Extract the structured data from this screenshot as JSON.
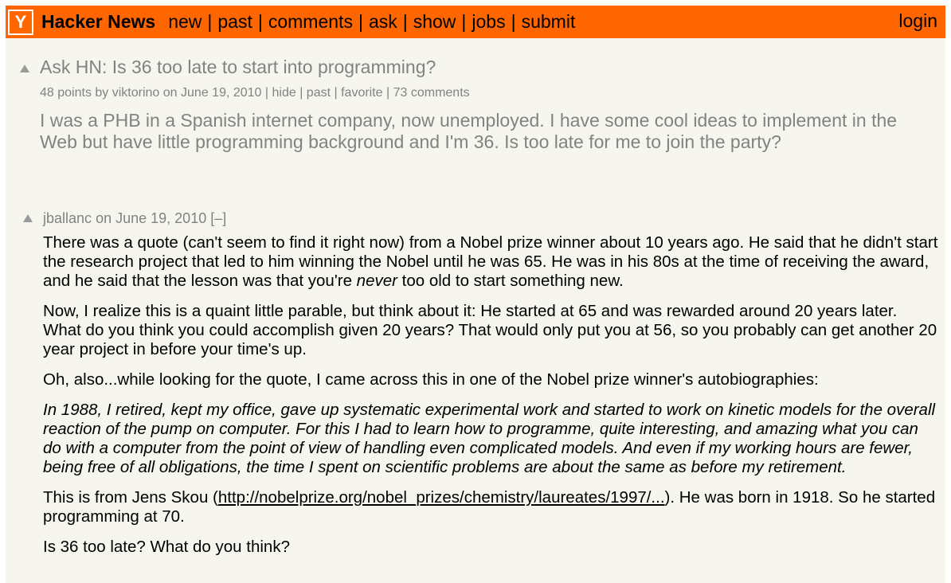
{
  "header": {
    "logo_letter": "Y",
    "site_name": "Hacker News",
    "nav": [
      "new",
      "past",
      "comments",
      "ask",
      "show",
      "jobs",
      "submit"
    ],
    "separator": "|",
    "login": "login"
  },
  "story": {
    "title": "Ask HN: Is 36 too late to start into programming?",
    "points": "48 points",
    "by": "by",
    "user": "viktorino",
    "on": "on",
    "date": "June 19, 2010",
    "hide": "hide",
    "past": "past",
    "favorite": "favorite",
    "comments": "73 comments",
    "text": "I was a PHB in a Spanish internet company, now unemployed. I have some cool ideas to implement in the Web but have little programming background and I'm 36. Is too late for me to join the party?"
  },
  "comment": {
    "user": "jballanc",
    "on": "on",
    "date": "June 19, 2010",
    "toggle": "[–]",
    "p1_before": "There was a quote (can't seem to find it right now) from a Nobel prize winner about 10 years ago. He said that he didn't start the research project that led to him winning the Nobel until he was 65. He was in his 80s at the time of receiving the award, and he said that the lesson was that you're ",
    "p1_em": "never",
    "p1_after": " too old to start something new.",
    "p2": "Now, I realize this is a quaint little parable, but think about it: He started at 65 and was rewarded around 20 years later. What do you think you could accomplish given 20 years? That would only put you at 56, so you probably can get another 20 year project in before your time's up.",
    "p3": "Oh, also...while looking for the quote, I came across this in one of the Nobel prize winner's autobiographies:",
    "p4": "In 1988, I retired, kept my office, gave up systematic experimental work and started to work on kinetic models for the overall reaction of the pump on computer. For this I had to learn how to programme, quite interesting, and amazing what you can do with a computer from the point of view of handling even complicated models. And even if my working hours are fewer, being free of all obligations, the time I spent on scientific problems are about the same as before my retirement.",
    "p5_before": "This is from Jens Skou (",
    "p5_link": "http://nobelprize.org/nobel_prizes/chemistry/laureates/1997/...",
    "p5_after": "). He was born in 1918. So he started programming at 70.",
    "p6": "Is 36 too late? What do you think?"
  }
}
